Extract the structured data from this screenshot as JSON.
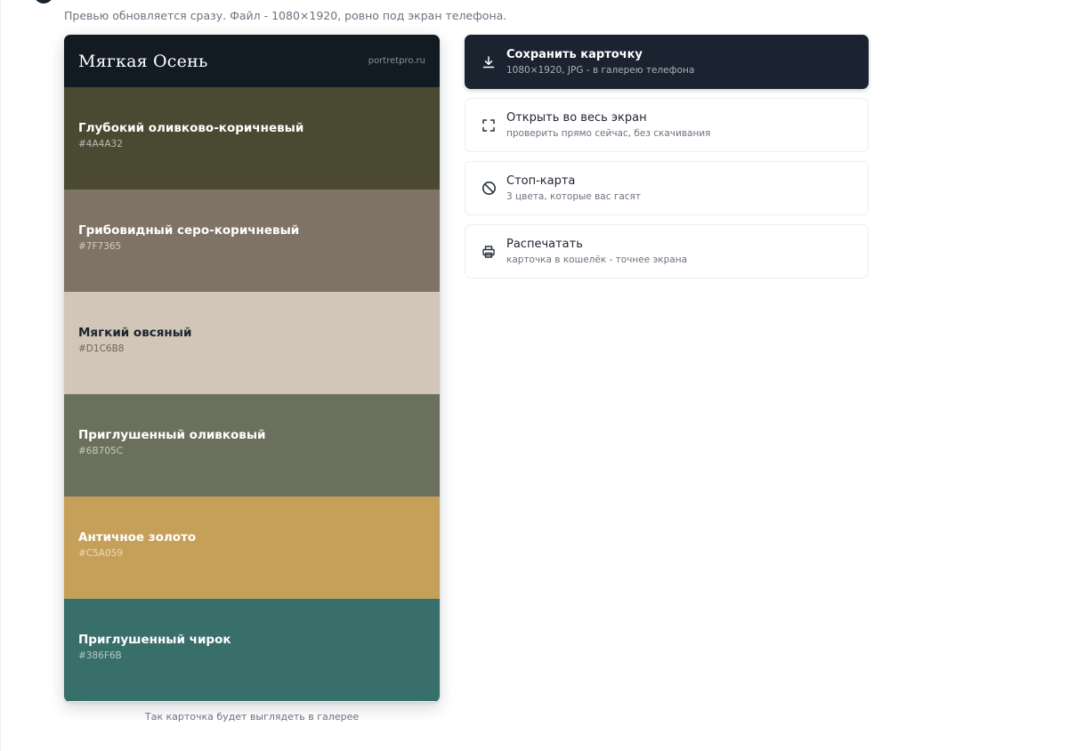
{
  "header": {
    "subtitle": "Превью обновляется сразу. Файл - 1080×1920, ровно под экран телефона."
  },
  "card": {
    "title": "Мягкая Осень",
    "site": "portretpro.ru",
    "swatches": [
      {
        "name": "Глубокий оливково-коричневый",
        "hex": "#4A4A32",
        "color": "#4A4A32"
      },
      {
        "name": "Грибовидный серо-коричневый",
        "hex": "#7F7365",
        "color": "#7F7365"
      },
      {
        "name": "Мягкий овсяный",
        "hex": "#D1C6B8",
        "color": "#D1C6B8"
      },
      {
        "name": "Приглушенный оливковый",
        "hex": "#6B705C",
        "color": "#6B705C"
      },
      {
        "name": "Античное золото",
        "hex": "#C5A059",
        "color": "#C5A059"
      },
      {
        "name": "Приглушенный чирок",
        "hex": "#386F6B",
        "color": "#386F6B"
      }
    ],
    "caption": "Так карточка будет выглядеть в галерее"
  },
  "actions": [
    {
      "title": "Сохранить карточку",
      "subtitle": "1080×1920, JPG - в галерею телефона",
      "icon": "download-icon"
    },
    {
      "title": "Открыть во весь экран",
      "subtitle": "проверить прямо сейчас, без скачивания",
      "icon": "fullscreen-icon"
    },
    {
      "title": "Стоп-карта",
      "subtitle": "3 цвета, которые вас гасят",
      "icon": "block-icon"
    },
    {
      "title": "Распечатать",
      "subtitle": "карточка в кошелёк - точнее экрана",
      "icon": "printer-icon"
    }
  ],
  "colors": {
    "primary_button": "#1B2330",
    "card_header": "#121A22"
  }
}
